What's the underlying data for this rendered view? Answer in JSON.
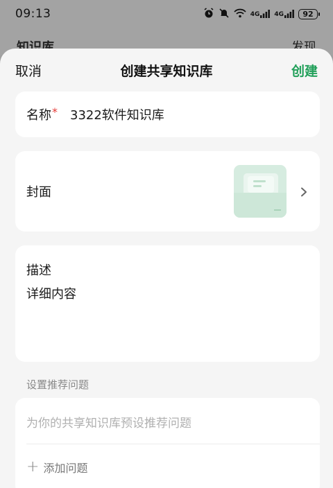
{
  "status_bar": {
    "time": "09:13",
    "icons": [
      "alarm-icon",
      "mute-icon",
      "wifi-icon",
      "signal-4g-icon",
      "signal-4g-icon"
    ],
    "network_label_1": "4G",
    "network_label_2": "4G",
    "battery": "92"
  },
  "background_page": {
    "title": "知识库",
    "action": "发现"
  },
  "sheet": {
    "cancel_label": "取消",
    "title": "创建共享知识库",
    "create_label": "创建",
    "accent_color": "#22a05a"
  },
  "name_field": {
    "label": "名称",
    "required_mark": "*",
    "value": "3322软件知识库"
  },
  "cover": {
    "label": "封面"
  },
  "description": {
    "label": "描述",
    "value": "详细内容"
  },
  "recommended_questions": {
    "section_label": "设置推荐问题",
    "placeholder": "为你的共享知识库预设推荐问题",
    "add_label": "添加问题"
  }
}
